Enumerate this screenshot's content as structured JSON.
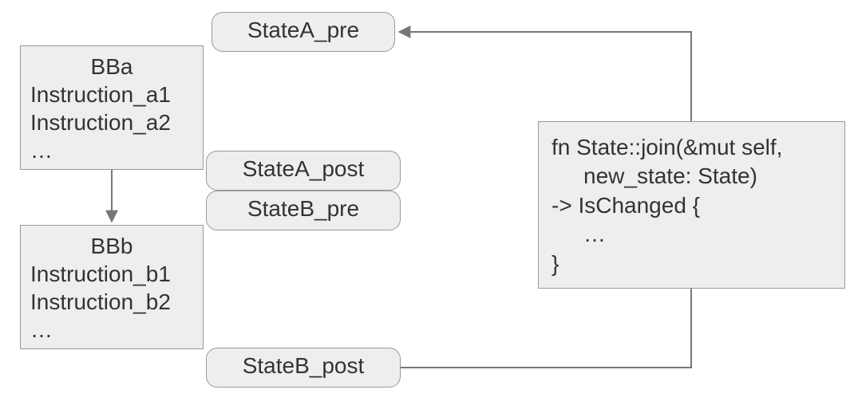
{
  "state_nodes": {
    "a_pre": "StateA_pre",
    "a_post": "StateA_post",
    "b_pre": "StateB_pre",
    "b_post": "StateB_post"
  },
  "blocks": {
    "bba": {
      "title": "BBa",
      "lines": [
        "Instruction_a1",
        "Instruction_a2",
        "…"
      ]
    },
    "bbb": {
      "title": "BBb",
      "lines": [
        "Instruction_b1",
        "Instruction_b2",
        "…"
      ]
    }
  },
  "code": {
    "sig1": "fn State::join(&mut self,",
    "sig2": "new_state: State)",
    "ret": "-> IsChanged {",
    "body": "…",
    "end": "}"
  },
  "colors": {
    "fill": "#eeeeee",
    "stroke": "#999999",
    "arrow": "#777777"
  }
}
